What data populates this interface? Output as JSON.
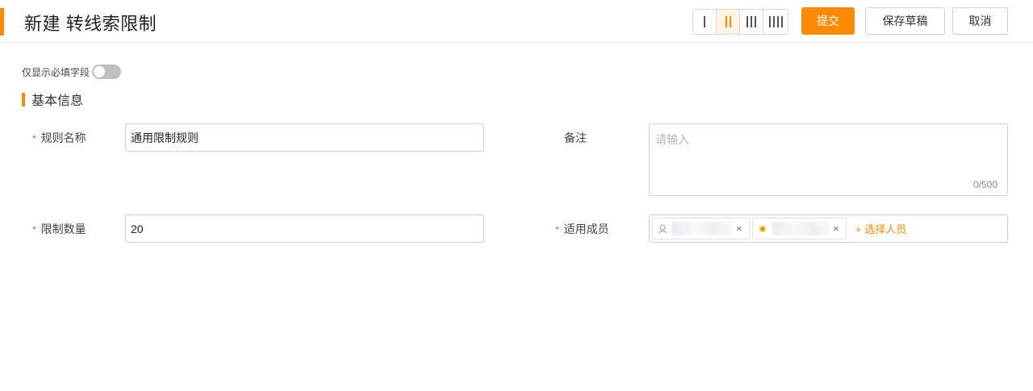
{
  "header": {
    "title": "新建 转线索限制",
    "column_options": [
      {
        "label": "I",
        "bars": 1,
        "active": false
      },
      {
        "label": "II",
        "bars": 2,
        "active": true
      },
      {
        "label": "III",
        "bars": 3,
        "active": false
      },
      {
        "label": "IIII",
        "bars": 4,
        "active": false
      }
    ],
    "submit_label": "提交",
    "draft_label": "保存草稿",
    "cancel_label": "取消"
  },
  "form": {
    "required_only_label": "仅显示必填字段",
    "required_only_enabled": false,
    "section_title": "基本信息",
    "fields": {
      "rule_name": {
        "label": "规则名称",
        "required": true,
        "value": "通用限制规则"
      },
      "note": {
        "label": "备注",
        "required": false,
        "placeholder": "请输入",
        "counter": "0/500"
      },
      "limit_count": {
        "label": "限制数量",
        "required": true,
        "value": "20"
      },
      "members": {
        "label": "适用成员",
        "required": true,
        "tags": [
          {
            "name": "",
            "icon": "user-avatar-icon"
          },
          {
            "name": "",
            "icon": "user-avatar-icon"
          }
        ],
        "add_label": "+ 选择人员"
      }
    }
  },
  "colors": {
    "accent": "#ff8a00",
    "required": "#f04d4d",
    "border": "#cfcfcf"
  }
}
